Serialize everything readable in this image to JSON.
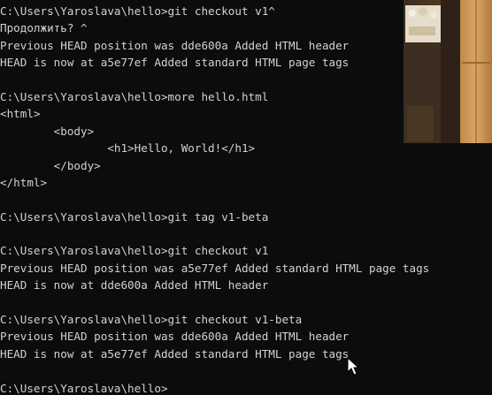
{
  "terminal": {
    "lines": [
      "C:\\Users\\Yaroslava\\hello>git checkout v1^",
      "Продолжить? ^",
      "Previous HEAD position was dde600a Added HTML header",
      "HEAD is now at a5e77ef Added standard HTML page tags",
      "",
      "C:\\Users\\Yaroslava\\hello>more hello.html",
      "<html>",
      "        <body>",
      "                <h1>Hello, World!</h1>",
      "        </body>",
      "</html>",
      "",
      "C:\\Users\\Yaroslava\\hello>git tag v1-beta",
      "",
      "C:\\Users\\Yaroslava\\hello>git checkout v1",
      "Previous HEAD position was a5e77ef Added standard HTML page tags",
      "HEAD is now at dde600a Added HTML header",
      "",
      "C:\\Users\\Yaroslava\\hello>git checkout v1-beta",
      "Previous HEAD position was dde600a Added HTML header",
      "HEAD is now at a5e77ef Added standard HTML page tags",
      "",
      "C:\\Users\\Yaroslava\\hello>"
    ]
  },
  "overlays": {
    "webcam_icon": "webcam-feed",
    "cursor_icon": "mouse-pointer"
  },
  "colors": {
    "background": "#0c0c0c",
    "text": "#d2d2d2"
  }
}
